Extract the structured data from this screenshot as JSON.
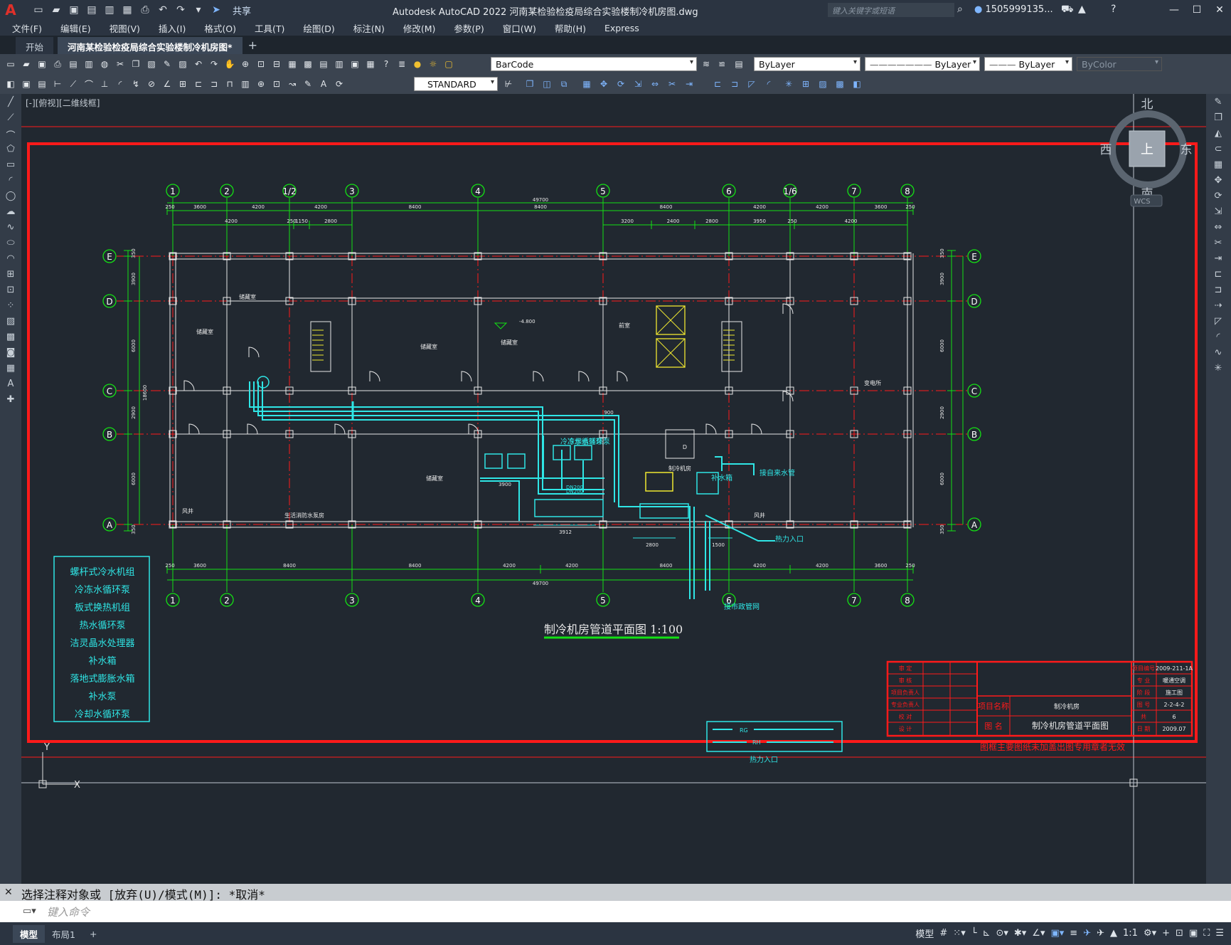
{
  "titlebar": {
    "logo": "A",
    "share_label": "共享",
    "title": "Autodesk AutoCAD 2022    河南某检验检疫局综合实验楼制冷机房图.dwg",
    "search_placeholder": "键入关键字或短语",
    "user": "1505999135...",
    "minimize": "—",
    "maximize": "☐",
    "close": "✕"
  },
  "menu": [
    "文件(F)",
    "编辑(E)",
    "视图(V)",
    "插入(I)",
    "格式(O)",
    "工具(T)",
    "绘图(D)",
    "标注(N)",
    "修改(M)",
    "参数(P)",
    "窗口(W)",
    "帮助(H)",
    "Express"
  ],
  "tabs": [
    "开始",
    "河南某检验检疫局综合实验楼制冷机房图*"
  ],
  "toolbar": {
    "layer_value": "BarCode",
    "color_value": "ByLayer",
    "linetype_value": "ByLayer",
    "lineweight_value": "ByLayer",
    "plotstyle_value": "ByColor",
    "textstyle_value": "STANDARD"
  },
  "viewport": {
    "label": "[-][俯视][二维线框]",
    "viewcube": {
      "top": "上",
      "north": "北",
      "south": "南",
      "east": "东",
      "west": "西",
      "wcs": "WCS"
    }
  },
  "drawing": {
    "title": "制冷机房管道平面图 1:100",
    "grid_top": [
      "1",
      "2",
      "1/2",
      "3",
      "4",
      "5",
      "6",
      "1/6",
      "7",
      "8"
    ],
    "grid_bottom": [
      "1",
      "2",
      "3",
      "4",
      "5",
      "6",
      "7",
      "8"
    ],
    "grid_side": [
      "E",
      "D",
      "C",
      "B",
      "A"
    ],
    "dim_total": "49700",
    "dims_top": [
      "250",
      "3600",
      "4200",
      "4200",
      "8400",
      "8400",
      "8400",
      "4200",
      "4200",
      "3600",
      "250"
    ],
    "dims_top2": [
      "4200",
      "250",
      "1150",
      "2800",
      "3200",
      "2400",
      "2800",
      "3950",
      "250",
      "4200"
    ],
    "dims_bottom": [
      "250",
      "3600",
      "8400",
      "8400",
      "4200",
      "4200",
      "8400",
      "4200",
      "4200",
      "3600",
      "250"
    ],
    "dims_side": [
      "350",
      "3900",
      "6000",
      "18600",
      "2900",
      "6000",
      "350"
    ],
    "rooms": [
      "储藏室",
      "储藏室",
      "储藏室",
      "储藏室",
      "前室",
      "变电所",
      "储藏室",
      "生活消防水泵房",
      "制冷机房",
      "风井",
      "风井",
      "D"
    ],
    "elevation": "-4.800",
    "pipe_labels": [
      "冷冻水循环泵",
      "冷却水循环泵",
      "DN200",
      "DN200",
      "接自来水管",
      "补水箱",
      "热力入口",
      "接市政管网"
    ],
    "pipe_dims": [
      "3900",
      "3912",
      "2800",
      "1500",
      "900"
    ],
    "legend": [
      "螺杆式冷水机组",
      "冷冻水循环泵",
      "板式换热机组",
      "热水循环泵",
      "洁灵晶水处理器",
      "补水箱",
      "落地式膨胀水箱",
      "补水泵",
      "冷却水循环泵"
    ],
    "small_legend": {
      "rg": "RG",
      "rh": "RH",
      "label": "热力入口"
    },
    "title_block": {
      "left_rows": [
        "审 定",
        "审 核",
        "项目负责人",
        "专业负责人",
        "校 对",
        "设 计"
      ],
      "project_label": "项目名称",
      "project_value": "制冷机房",
      "drawing_label": "图 名",
      "drawing_value": "制冷机房管道平面图",
      "right_rows": [
        [
          "项目编号",
          "2009-211-1A"
        ],
        [
          "专 业",
          "暖通空调"
        ],
        [
          "阶 段",
          "施工图"
        ],
        [
          "图 号",
          "2-2-4-2"
        ],
        [
          "共",
          "6"
        ],
        [
          "日 期",
          "2009.07"
        ]
      ],
      "note": "图框主要图纸未加盖出图专用章者无效"
    }
  },
  "command": {
    "history": "选择注释对象或 [放弃(U)/模式(M)]: *取消*",
    "placeholder": "键入命令"
  },
  "status": {
    "model_label": "模型",
    "layout_tab": "布局1",
    "model_tab": "模型",
    "scale": "1:1"
  },
  "colors": {
    "bg": "#212830",
    "red": "#ff1a1a",
    "green": "#14e014",
    "cyan": "#2fe6e6",
    "yellow": "#f0e830",
    "white": "#e8e8e8"
  }
}
